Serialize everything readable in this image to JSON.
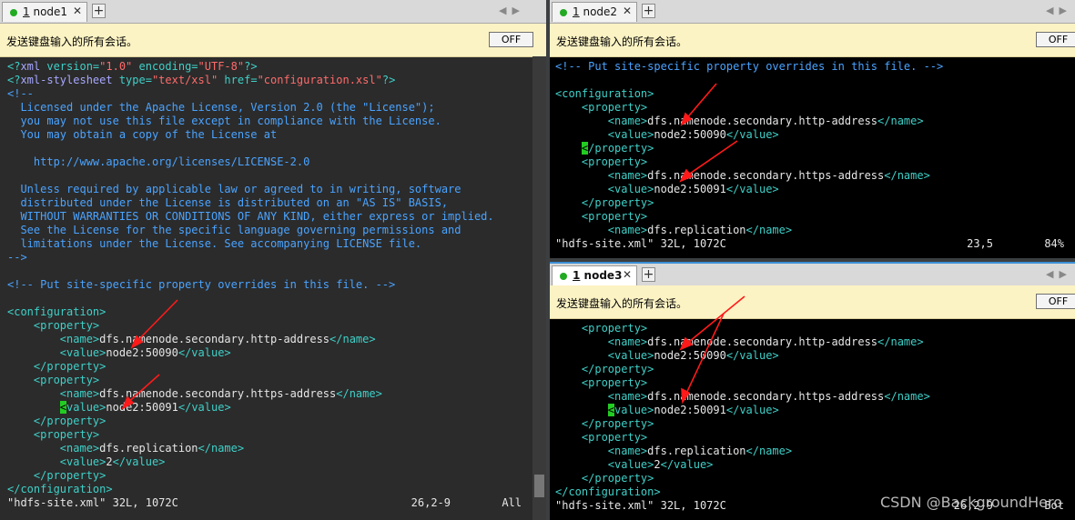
{
  "notification_text": "发送键盘输入的所有会话。",
  "off_label": "OFF",
  "left": {
    "tab": {
      "number": "1",
      "name": "node1"
    },
    "lines": [
      [
        [
          "tg",
          "<?"
        ],
        [
          "kw",
          "xml "
        ],
        [
          "tg",
          "version="
        ],
        [
          "st",
          "\"1.0\""
        ],
        [
          "tg",
          " encoding="
        ],
        [
          "st",
          "\"UTF-8\""
        ],
        [
          "tg",
          "?>"
        ]
      ],
      [
        [
          "tg",
          "<?"
        ],
        [
          "kw",
          "xml-stylesheet "
        ],
        [
          "tg",
          "type="
        ],
        [
          "st",
          "\"text/xsl\""
        ],
        [
          "tg",
          " href="
        ],
        [
          "st",
          "\"configuration.xsl\""
        ],
        [
          "tg",
          "?>"
        ]
      ],
      [
        [
          "cm",
          "<!--"
        ]
      ],
      [
        [
          "cm",
          "  Licensed under the Apache License, Version 2.0 (the \"License\");"
        ]
      ],
      [
        [
          "cm",
          "  you may not use this file except in compliance with the License."
        ]
      ],
      [
        [
          "cm",
          "  You may obtain a copy of the License at"
        ]
      ],
      [
        [
          "cm",
          ""
        ]
      ],
      [
        [
          "cm",
          "    http://www.apache.org/licenses/LICENSE-2.0"
        ]
      ],
      [
        [
          "cm",
          ""
        ]
      ],
      [
        [
          "cm",
          "  Unless required by applicable law or agreed to in writing, software"
        ]
      ],
      [
        [
          "cm",
          "  distributed under the License is distributed on an \"AS IS\" BASIS,"
        ]
      ],
      [
        [
          "cm",
          "  WITHOUT WARRANTIES OR CONDITIONS OF ANY KIND, either express or implied."
        ]
      ],
      [
        [
          "cm",
          "  See the License for the specific language governing permissions and"
        ]
      ],
      [
        [
          "cm",
          "  limitations under the License. See accompanying LICENSE file."
        ]
      ],
      [
        [
          "cm",
          "-->"
        ]
      ],
      [
        [
          "tx",
          ""
        ]
      ],
      [
        [
          "cm",
          "<!-- Put site-specific property overrides in this file. -->"
        ]
      ],
      [
        [
          "tx",
          ""
        ]
      ],
      [
        [
          "tg",
          "<configuration>"
        ]
      ],
      [
        [
          "tg",
          "    <property>"
        ]
      ],
      [
        [
          "tg",
          "        <name>"
        ],
        [
          "tx",
          "dfs.namenode.secondary.http-address"
        ],
        [
          "tg",
          "</name>"
        ]
      ],
      [
        [
          "tg",
          "        <value>"
        ],
        [
          "tx",
          "node2:50090"
        ],
        [
          "tg",
          "</value>"
        ]
      ],
      [
        [
          "tg",
          "    </property>"
        ]
      ],
      [
        [
          "tg",
          "    <property>"
        ]
      ],
      [
        [
          "tg",
          "        <name>"
        ],
        [
          "tx",
          "dfs.namenode.secondary.https-address"
        ],
        [
          "tg",
          "</name>"
        ]
      ],
      [
        [
          "tg",
          "        "
        ],
        [
          "curs",
          "<"
        ],
        [
          "tg",
          "value>"
        ],
        [
          "tx",
          "node2:50091"
        ],
        [
          "tg",
          "</value>"
        ]
      ],
      [
        [
          "tg",
          "    </property>"
        ]
      ],
      [
        [
          "tg",
          "    <property>"
        ]
      ],
      [
        [
          "tg",
          "        <name>"
        ],
        [
          "tx",
          "dfs.replication"
        ],
        [
          "tg",
          "</name>"
        ]
      ],
      [
        [
          "tg",
          "        <value>"
        ],
        [
          "tx",
          "2"
        ],
        [
          "tg",
          "</value>"
        ]
      ],
      [
        [
          "tg",
          "    </property>"
        ]
      ],
      [
        [
          "tg",
          "</configuration>"
        ]
      ]
    ],
    "status": {
      "file": "\"hdfs-site.xml\" 32L, 1072C",
      "pos": "26,2-9",
      "pct": "All"
    }
  },
  "right_top": {
    "tab": {
      "number": "1",
      "name": "node2"
    },
    "lines": [
      [
        [
          "cm",
          "<!-- Put site-specific property overrides in this file. -->"
        ]
      ],
      [
        [
          "tx",
          ""
        ]
      ],
      [
        [
          "tg",
          "<configuration>"
        ]
      ],
      [
        [
          "tg",
          "    <property>"
        ]
      ],
      [
        [
          "tg",
          "        <name>"
        ],
        [
          "tx",
          "dfs.namenode.secondary.http-address"
        ],
        [
          "tg",
          "</name>"
        ]
      ],
      [
        [
          "tg",
          "        <value>"
        ],
        [
          "tx",
          "node2:50090"
        ],
        [
          "tg",
          "</value>"
        ]
      ],
      [
        [
          "tg",
          "    "
        ],
        [
          "curs",
          "<"
        ],
        [
          "tg",
          "/property>"
        ]
      ],
      [
        [
          "tg",
          "    <property>"
        ]
      ],
      [
        [
          "tg",
          "        <name>"
        ],
        [
          "tx",
          "dfs.namenode.secondary.https-address"
        ],
        [
          "tg",
          "</name>"
        ]
      ],
      [
        [
          "tg",
          "        <value>"
        ],
        [
          "tx",
          "node2:50091"
        ],
        [
          "tg",
          "</value>"
        ]
      ],
      [
        [
          "tg",
          "    </property>"
        ]
      ],
      [
        [
          "tg",
          "    <property>"
        ]
      ],
      [
        [
          "tg",
          "        <name>"
        ],
        [
          "tx",
          "dfs.replication"
        ],
        [
          "tg",
          "</name>"
        ]
      ]
    ],
    "status": {
      "file": "\"hdfs-site.xml\" 32L, 1072C",
      "pos": "23,5",
      "pct": "84%"
    }
  },
  "right_bottom": {
    "tab": {
      "number": "1",
      "name": "node3"
    },
    "lines": [
      [
        [
          "tg",
          "    <property>"
        ]
      ],
      [
        [
          "tg",
          "        <name>"
        ],
        [
          "tx",
          "dfs.namenode.secondary.http-address"
        ],
        [
          "tg",
          "</name>"
        ]
      ],
      [
        [
          "tg",
          "        <value>"
        ],
        [
          "tx",
          "node2:50090"
        ],
        [
          "tg",
          "</value>"
        ]
      ],
      [
        [
          "tg",
          "    </property>"
        ]
      ],
      [
        [
          "tg",
          "    <property>"
        ]
      ],
      [
        [
          "tg",
          "        <name>"
        ],
        [
          "tx",
          "dfs.namenode.secondary.https-address"
        ],
        [
          "tg",
          "</name>"
        ]
      ],
      [
        [
          "tg",
          "        "
        ],
        [
          "curs",
          "<"
        ],
        [
          "tg",
          "value>"
        ],
        [
          "tx",
          "node2:50091"
        ],
        [
          "tg",
          "</value>"
        ]
      ],
      [
        [
          "tg",
          "    </property>"
        ]
      ],
      [
        [
          "tg",
          "    <property>"
        ]
      ],
      [
        [
          "tg",
          "        <name>"
        ],
        [
          "tx",
          "dfs.replication"
        ],
        [
          "tg",
          "</name>"
        ]
      ],
      [
        [
          "tg",
          "        <value>"
        ],
        [
          "tx",
          "2"
        ],
        [
          "tg",
          "</value>"
        ]
      ],
      [
        [
          "tg",
          "    </property>"
        ]
      ],
      [
        [
          "tg",
          "</configuration>"
        ]
      ]
    ],
    "status": {
      "file": "\"hdfs-site.xml\" 32L, 1072C",
      "pos": "26,2-9",
      "pct": "Bot"
    }
  },
  "watermark": "CSDN @BackgroundHero",
  "icons": {
    "nav_left": "triangle-left-icon",
    "nav_right": "triangle-right-icon",
    "tab_close": "close-icon",
    "new_tab": "plus-icon"
  }
}
